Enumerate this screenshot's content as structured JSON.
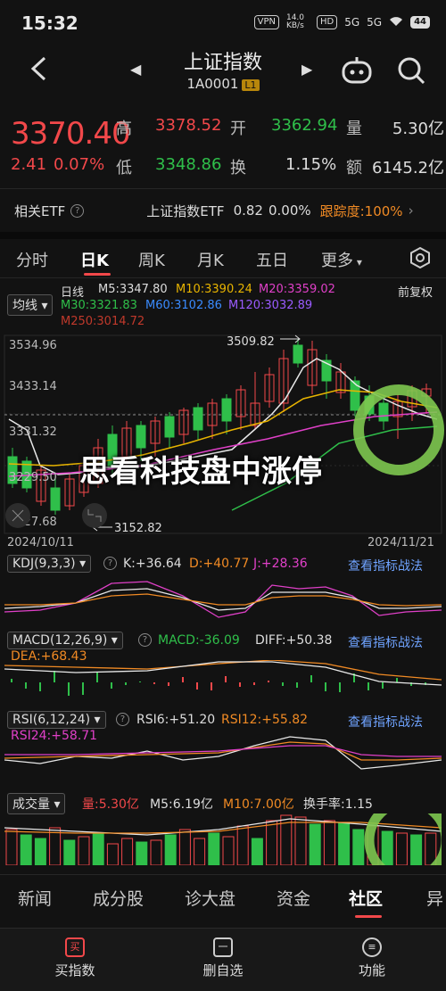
{
  "status": {
    "time": "15:32",
    "vpn": "VPN",
    "speed": "14.0 KB/s",
    "hd": "HD",
    "sig1": "5G",
    "sig2": "5G",
    "battery": "44"
  },
  "nav": {
    "title": "上证指数",
    "code": "1A0001",
    "level_tag": "L1"
  },
  "quote": {
    "price": "3370.40",
    "change": "2.41",
    "change_pct": "0.07%",
    "high_label": "高",
    "high": "3378.52",
    "open_label": "开",
    "open": "3362.94",
    "vol_label": "量",
    "vol": "5.30亿",
    "low_label": "低",
    "low": "3348.86",
    "turnover_label": "换",
    "turnover": "1.15%",
    "amount_label": "额",
    "amount": "6145.2亿"
  },
  "etf": {
    "label": "相关ETF",
    "name": "上证指数ETF",
    "price": "0.82",
    "pct": "0.00%",
    "track_label": "跟踪度:100%"
  },
  "tabs": [
    "分时",
    "日K",
    "周K",
    "月K",
    "五日",
    "更多"
  ],
  "ma": {
    "selector": "均线",
    "period": "日线",
    "adjust": "前复权",
    "m5": "M5:3347.80",
    "m10": "M10:3390.24",
    "m20": "M20:3359.02",
    "m30": "M30:3321.83",
    "m60": "M60:3102.86",
    "m120": "M120:3032.89",
    "m250": "M250:3014.72"
  },
  "kline": {
    "y_labels": [
      "3534.96",
      "3433.14",
      "3331.32",
      "3229.50",
      "3127.68"
    ],
    "peak_label": "3509.82",
    "low_label": "3152.82",
    "date_start": "2024/10/11",
    "date_end": "2024/11/21"
  },
  "kdj": {
    "selector": "KDJ(9,3,3)",
    "k": "K:+36.64",
    "d": "D:+40.77",
    "j": "J:+28.36",
    "link": "查看指标战法"
  },
  "macd": {
    "selector": "MACD(12,26,9)",
    "macd": "MACD:-36.09",
    "diff": "DIFF:+50.38",
    "dea": "DEA:+68.43",
    "link": "查看指标战法"
  },
  "rsi": {
    "selector": "RSI(6,12,24)",
    "rsi6": "RSI6:+51.20",
    "rsi12": "RSI12:+55.82",
    "rsi24": "RSI24:+58.71",
    "link": "查看指标战法"
  },
  "volume": {
    "selector": "成交量",
    "vol": "量:5.30亿",
    "m5": "M5:6.19亿",
    "m10": "M10:7.00亿",
    "turn": "换手率:1.15"
  },
  "overlay_title": "思看科技盘中涨停",
  "bottom_tabs": [
    "新闻",
    "成分股",
    "诊大盘",
    "资金",
    "社区",
    "异"
  ],
  "actions": [
    {
      "icon": "买",
      "label": "买指数"
    },
    {
      "icon": "一",
      "label": "删自选"
    },
    {
      "icon": "≡",
      "label": "功能"
    }
  ],
  "colors": {
    "up": "#f2484a",
    "down": "#2fbf4a",
    "accent": "#f2484a",
    "link": "#6fa3ff"
  }
}
